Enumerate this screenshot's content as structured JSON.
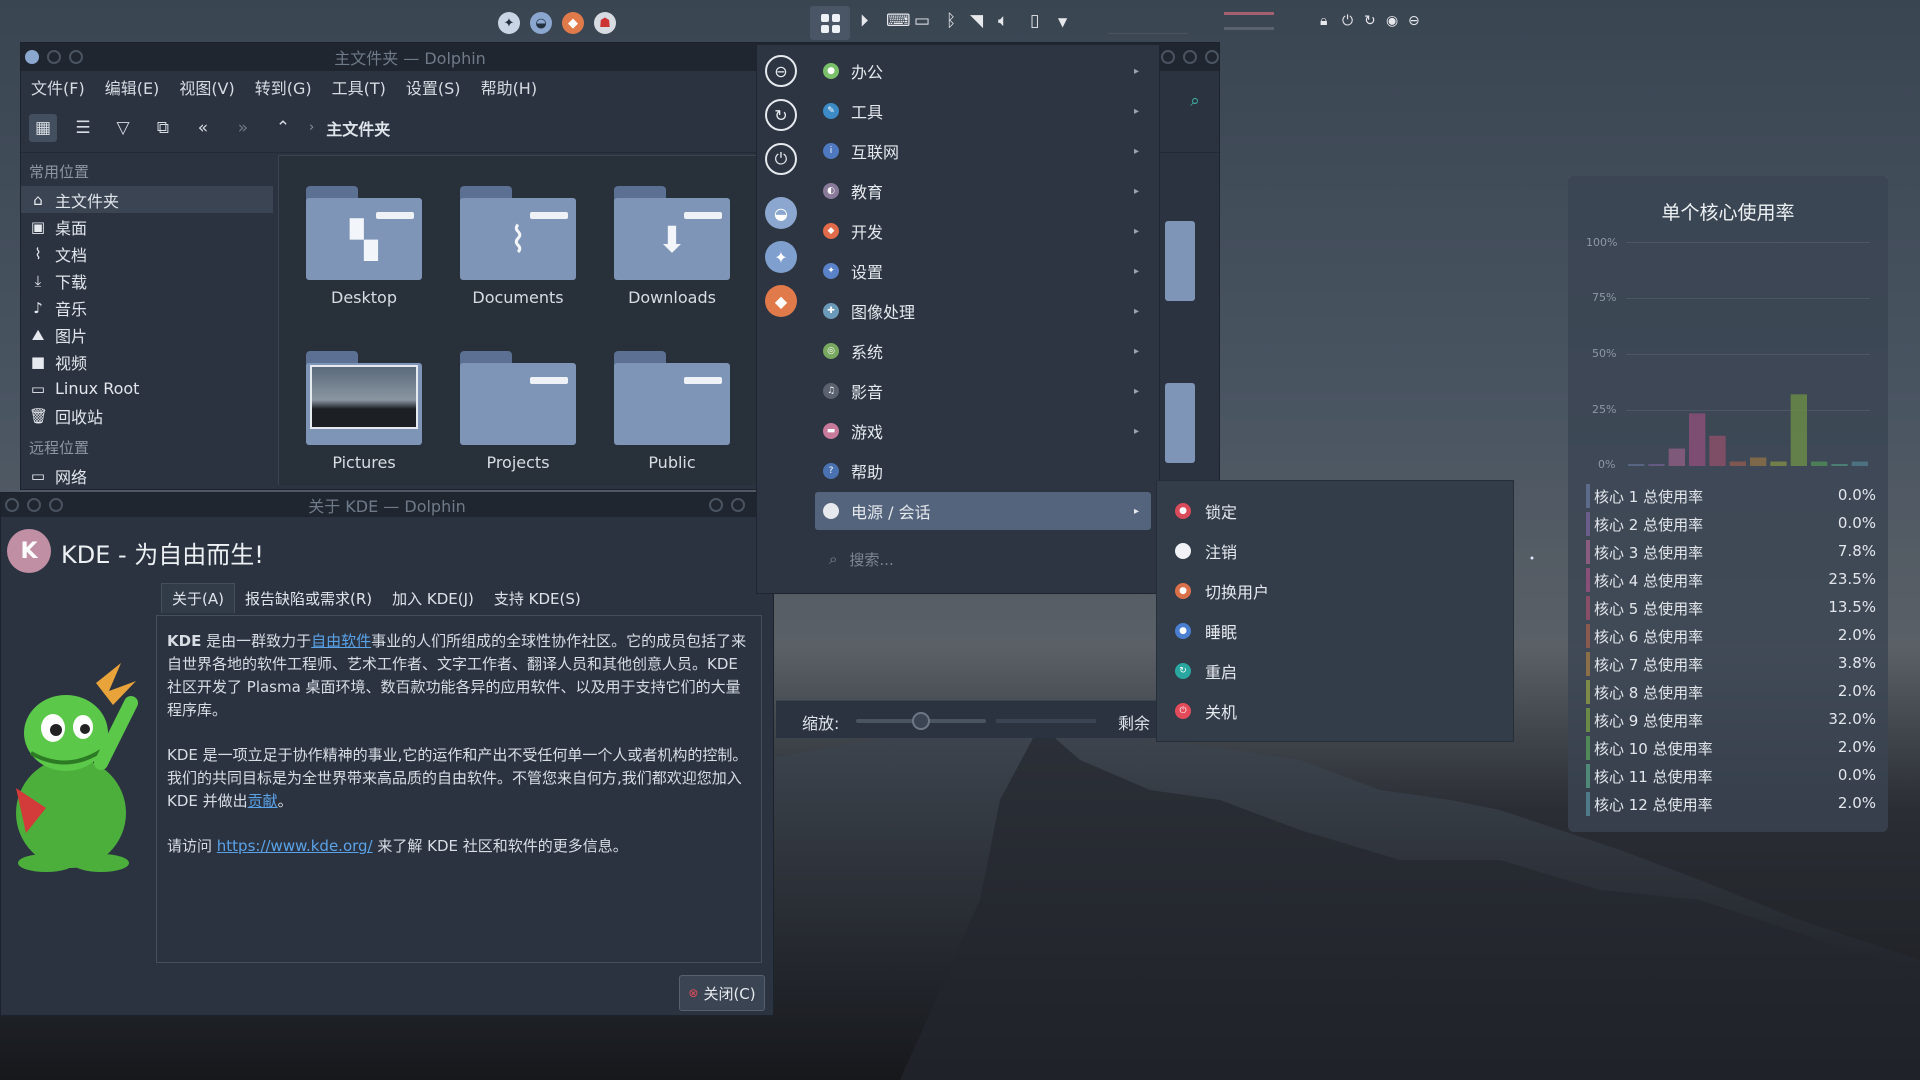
{
  "theme": {
    "accent": "#53647c",
    "link": "#5aa2e8"
  },
  "dolphin": {
    "title": "主文件夹 — Dolphin",
    "menus": [
      "文件(F)",
      "编辑(E)",
      "视图(V)",
      "转到(G)",
      "工具(T)",
      "设置(S)",
      "帮助(H)"
    ],
    "breadcrumb": "主文件夹",
    "places_header": "常用位置",
    "places": [
      "主文件夹",
      "桌面",
      "文档",
      "下载",
      "音乐",
      "图片",
      "视频",
      "Linux Root",
      "回收站"
    ],
    "remote_header": "远程位置",
    "remote": [
      "网络"
    ],
    "folders": [
      "Desktop",
      "Documents",
      "Downloads",
      "Pictures",
      "Projects",
      "Public"
    ],
    "zoom_label": "缩放:",
    "remaining_label": "剩余"
  },
  "about": {
    "title": "关于 KDE — Dolphin",
    "heading": "KDE - 为自由而生!",
    "tabs": [
      "关于(A)",
      "报告缺陷或需求(R)",
      "加入 KDE(J)",
      "支持 KDE(S)"
    ],
    "p1_bold": "KDE",
    "p1_a": " 是由一群致力于",
    "p1_link": "自由软件",
    "p1_b": "事业的人们所组成的全球性协作社区。它的成员包括了来自世界各地的软件工程师、艺术工作者、文字工作者、翻译人员和其他创意人员。KDE 社区开发了 Plasma 桌面环境、数百款功能各异的应用软件、以及用于支持它们的大量程序库。",
    "p2_a": "KDE 是一项立足于协作精神的事业,它的运作和产出不受任何单一个人或者机构的控制。我们的共同目标是为全世界带来高品质的自由软件。不管您来自何方,我们都欢迎您加入 KDE 并做出",
    "p2_link": "贡献",
    "p2_b": "。",
    "p3_a": "请访问 ",
    "p3_link": "https://www.kde.org/",
    "p3_b": " 来了解 KDE 社区和软件的更多信息。",
    "close": "关闭(C)"
  },
  "launcher": {
    "categories": [
      "办公",
      "工具",
      "互联网",
      "教育",
      "开发",
      "设置",
      "图像处理",
      "系统",
      "影音",
      "游戏",
      "帮助",
      "电源 / 会话"
    ],
    "selected": "电源 / 会话",
    "search_placeholder": "搜索...",
    "submenu": [
      "锁定",
      "注销",
      "切换用户",
      "睡眠",
      "重启",
      "关机"
    ]
  },
  "cpu_widget": {
    "title": "单个核心使用率",
    "axis": [
      "100%",
      "75%",
      "50%",
      "25%",
      "0%"
    ],
    "cores": [
      {
        "name": "核心 1 总使用率",
        "value": "0.0%",
        "color": "#5d6b8a"
      },
      {
        "name": "核心 2 总使用率",
        "value": "0.0%",
        "color": "#6a5d8a"
      },
      {
        "name": "核心 3 总使用率",
        "value": "7.8%",
        "color": "#8a5d80"
      },
      {
        "name": "核心 4 总使用率",
        "value": "23.5%",
        "color": "#8a4f78"
      },
      {
        "name": "核心 5 总使用率",
        "value": "13.5%",
        "color": "#8a4f68"
      },
      {
        "name": "核心 6 总使用率",
        "value": "2.0%",
        "color": "#8a5a50"
      },
      {
        "name": "核心 7 总使用率",
        "value": "3.8%",
        "color": "#8a6f48"
      },
      {
        "name": "核心 8 总使用率",
        "value": "2.0%",
        "color": "#7d8a48"
      },
      {
        "name": "核心 9 总使用率",
        "value": "32.0%",
        "color": "#6a8a48"
      },
      {
        "name": "核心 10 总使用率",
        "value": "2.0%",
        "color": "#4f8a58"
      },
      {
        "name": "核心 11 总使用率",
        "value": "0.0%",
        "color": "#4f8a78"
      },
      {
        "name": "核心 12 总使用率",
        "value": "2.0%",
        "color": "#4f7a8a"
      }
    ]
  }
}
